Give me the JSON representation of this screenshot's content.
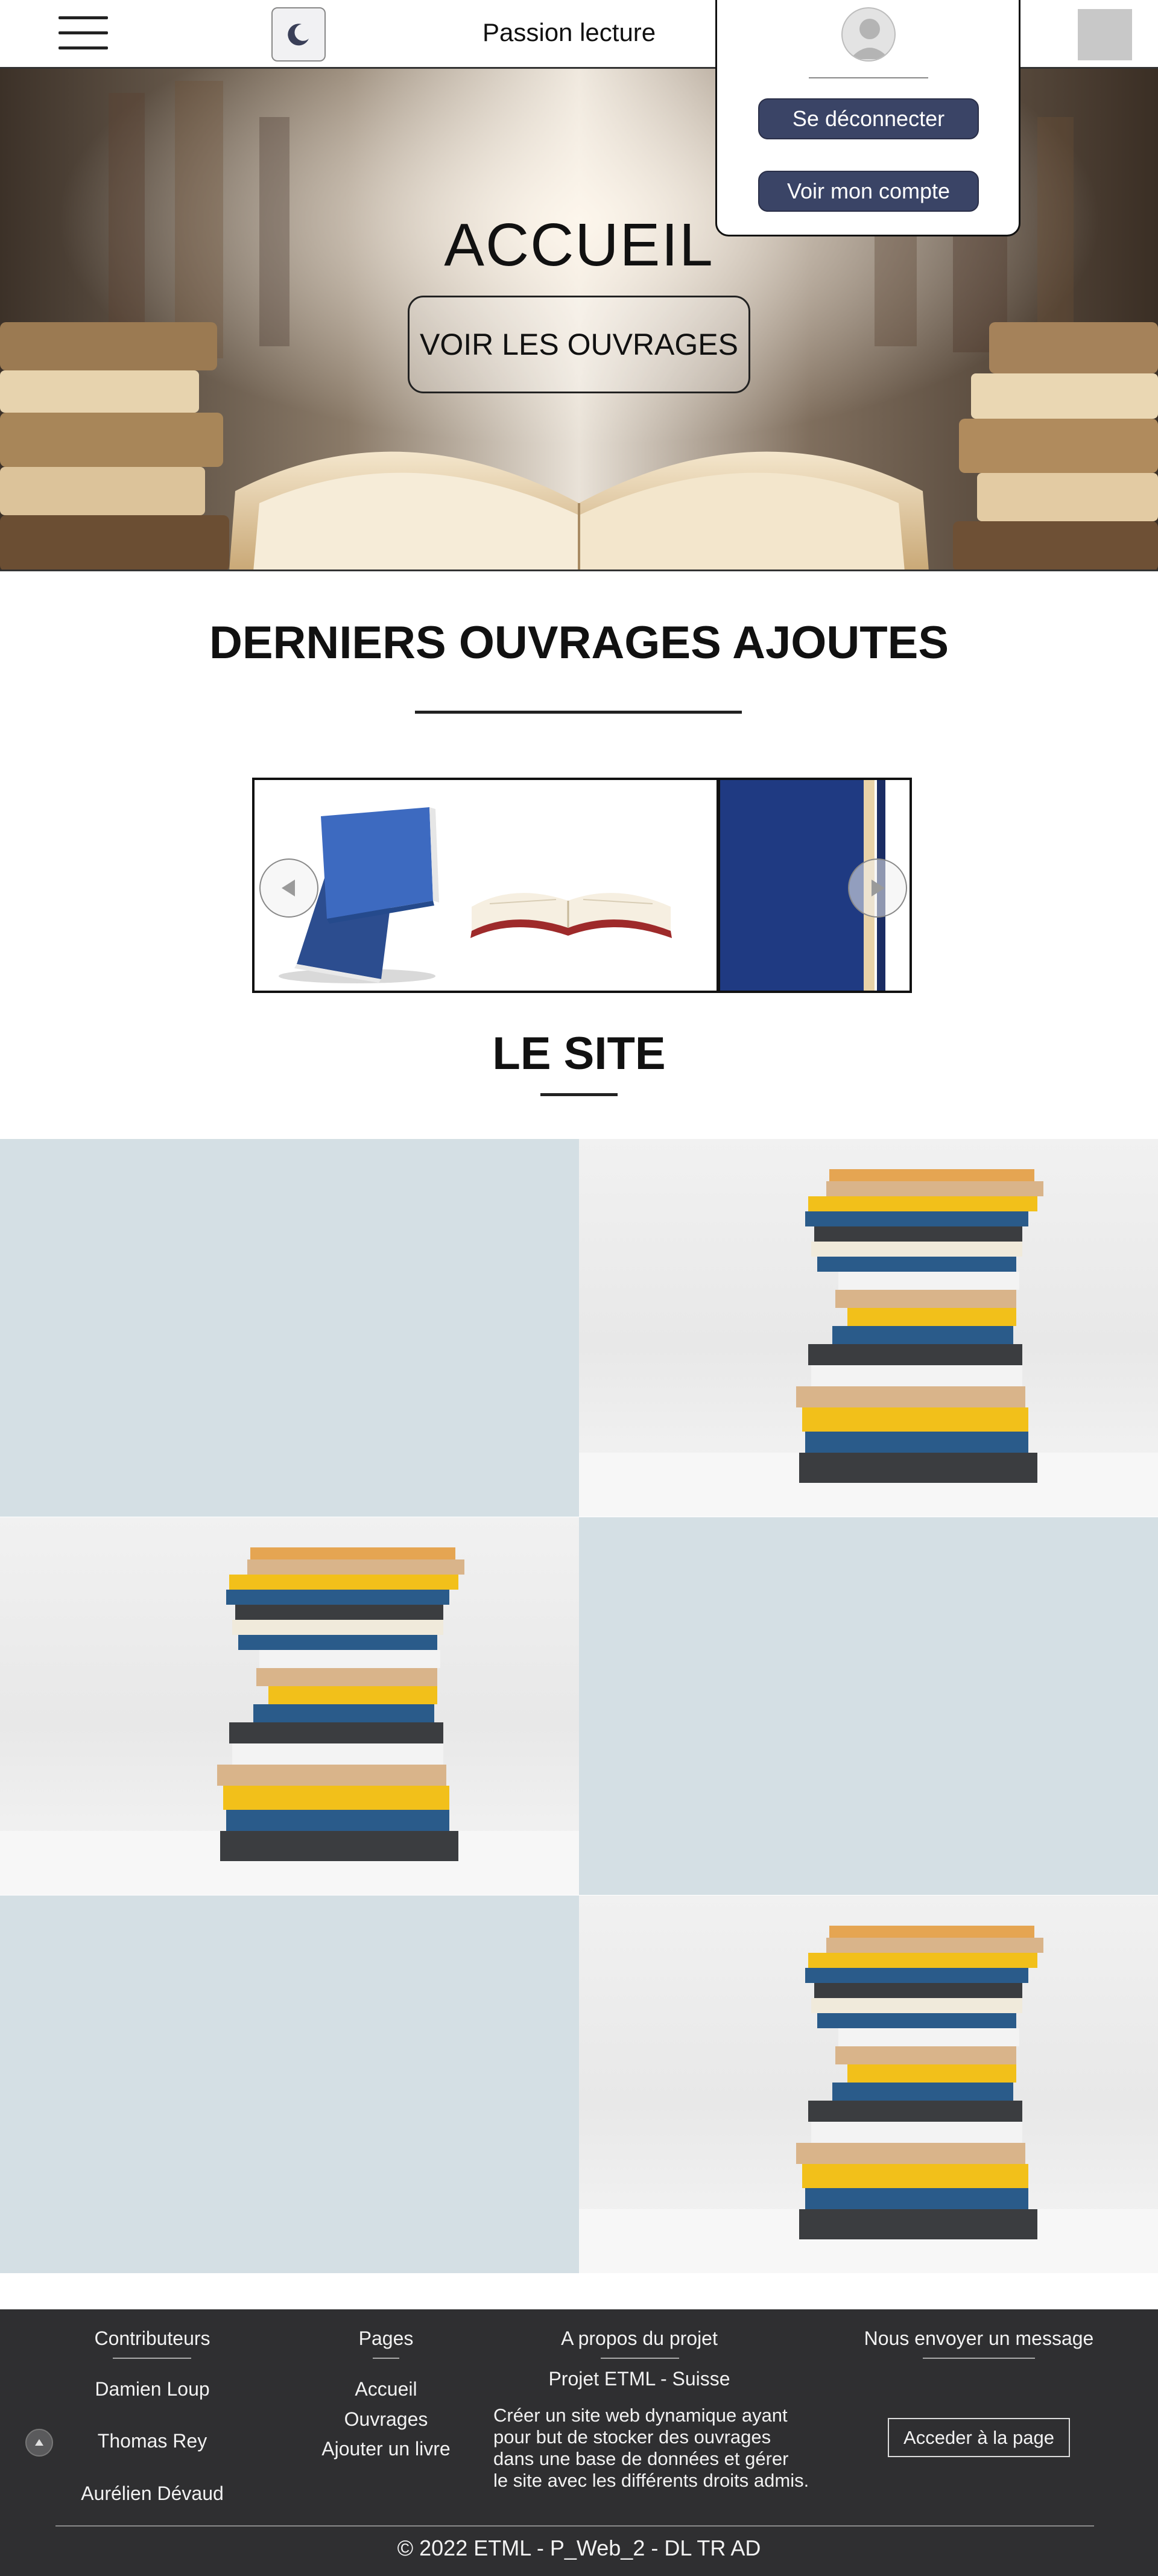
{
  "header": {
    "site_title": "Passion lecture",
    "menu_icon": "hamburger-menu-icon",
    "theme_icon": "moon-icon"
  },
  "account_menu": {
    "logout_label": "Se déconnecter",
    "account_label": "Voir mon compte",
    "avatar_icon": "user-avatar-icon"
  },
  "hero": {
    "title": "ACCUEIL",
    "button_label": "VOIR LES OUVRAGES"
  },
  "latest": {
    "title": "DERNIERS OUVRAGES AJOUTES"
  },
  "site_section": {
    "title": "LE SITE"
  },
  "footer": {
    "contributors_title": "Contributeurs",
    "contributors": [
      "Damien Loup",
      "Thomas Rey",
      "Aurélien Dévaud"
    ],
    "pages_title": "Pages",
    "pages": [
      "Accueil",
      "Ouvrages",
      "Ajouter un livre"
    ],
    "about_title": "A propos du projet",
    "about_subtitle": "Projet ETML - Suisse",
    "about_lines": [
      "Créer un site web dynamique ayant",
      "pour but de stocker des ouvrages",
      "dans une base de données et gérer",
      "le site avec les différents droits admis."
    ],
    "message_title": "Nous envoyer un message",
    "access_label": "Acceder à la page",
    "copyright": "© 2022 ETML - P_Web_2 - DL TR AD"
  },
  "colors": {
    "accent_button": "#3a4466",
    "footer_bg": "#2f2f31",
    "tile_blank": "#d4dfe4"
  }
}
